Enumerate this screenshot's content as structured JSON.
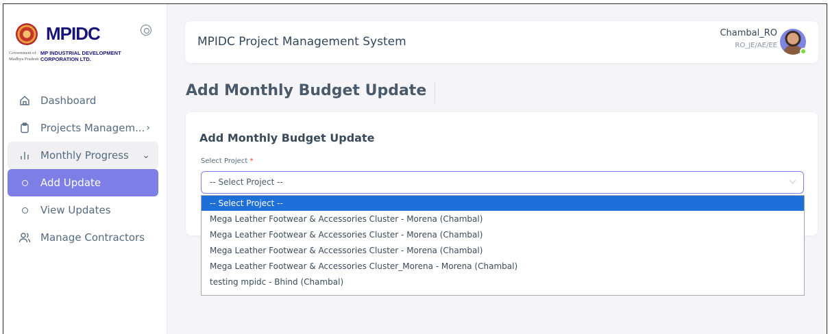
{
  "sidebar": {
    "logo": {
      "word": "MPIDC",
      "gov_line1": "Government of",
      "gov_line2": "Madhya Pradesh",
      "corp_line1": "MP INDUSTRIAL DEVELOPMENT",
      "corp_line2": "CORPORATION LTD."
    },
    "items": [
      {
        "label": "Dashboard",
        "icon": "home-icon"
      },
      {
        "label": "Projects Managem...",
        "icon": "clipboard-icon",
        "arrow": "›"
      },
      {
        "label": "Monthly Progress",
        "icon": "bar-chart-icon",
        "arrow": "⌄"
      },
      {
        "label": "Add Update",
        "icon": "circle-icon"
      },
      {
        "label": "View Updates",
        "icon": "circle-icon"
      },
      {
        "label": "Manage Contractors",
        "icon": "users-icon"
      }
    ]
  },
  "header": {
    "app_title": "MPIDC Project Management System",
    "user_name": "Chambal_RO",
    "user_role": "RO_JE/AE/EE"
  },
  "page": {
    "title": "Add Monthly Budget Update"
  },
  "form": {
    "card_title": "Add Monthly Budget Update",
    "select_label": "Select Project",
    "required_mark": "*",
    "select_value": "-- Select Project --",
    "options": [
      "-- Select Project --",
      "Mega Leather Footwear & Accessories Cluster - Morena (Chambal)",
      "Mega Leather Footwear & Accessories Cluster - Morena (Chambal)",
      "Mega Leather Footwear & Accessories Cluster - Morena (Chambal)",
      "Mega Leather Footwear & Accessories Cluster_Morena - Morena (Chambal)",
      "testing mpidc - Bhind (Chambal)"
    ],
    "selected_option_index": 0
  },
  "colors": {
    "accent": "#7e7fe6",
    "selected_option": "#1e6fd9",
    "online_status": "#71dd37"
  }
}
